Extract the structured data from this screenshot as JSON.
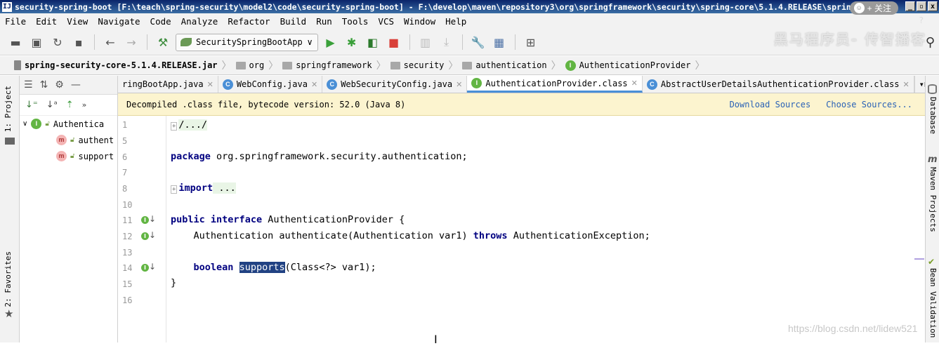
{
  "window": {
    "title": "security-spring-boot [F:\\teach\\spring-security\\model2\\code\\security-spring-boot] - F:\\develop\\maven\\repository3\\org\\springframework\\security\\spring-core\\5.1.4.RELEASE\\sprin...",
    "min": "_",
    "max": "▫",
    "close": "x"
  },
  "menu": [
    "File",
    "Edit",
    "View",
    "Navigate",
    "Code",
    "Analyze",
    "Refactor",
    "Build",
    "Run",
    "Tools",
    "VCS",
    "Window",
    "Help"
  ],
  "follow_button": "+ 关注",
  "help_glyph": "?",
  "watermark": "黑马程序员- 传智播客",
  "run_config": "SecuritySpringBootApp",
  "breadcrumb": {
    "jar": "spring-security-core-5.1.4.RELEASE.jar",
    "parts": [
      "org",
      "springframework",
      "security",
      "authentication"
    ],
    "class_badge": "I",
    "class_name": "AuthenticationProvider"
  },
  "side_tabs": {
    "project": "1: Project",
    "favorites": "2: Favorites"
  },
  "structure": {
    "root": "Authentica",
    "items": [
      "authent",
      "support"
    ]
  },
  "tabs": [
    {
      "label": "ringBootApp.java",
      "badge": ""
    },
    {
      "label": "WebConfig.java",
      "badge": "C"
    },
    {
      "label": "WebSecurityConfig.java",
      "badge": "C"
    },
    {
      "label": "AuthenticationProvider.class",
      "badge": "I",
      "active": true
    },
    {
      "label": "AbstractUserDetailsAuthenticationProvider.class",
      "badge": "C"
    }
  ],
  "tab_overflow": "▾≡₂",
  "notice": {
    "text": "Decompiled .class file, bytecode version: 52.0 (Java 8)",
    "download": "Download Sources",
    "choose": "Choose Sources..."
  },
  "line_numbers": [
    "1",
    "5",
    "6",
    "7",
    "8",
    "10",
    "11",
    "12",
    "13",
    "14",
    "15",
    "16"
  ],
  "code": {
    "l1_fold": "/.../",
    "l6_kw": "package",
    "l6_rest": " org.springframework.security.authentication;",
    "l8_kw": "import",
    "l8_fold": " ...",
    "l11_kw1": "public",
    "l11_kw2": "interface",
    "l11_rest": " AuthenticationProvider {",
    "l12_a": "    Authentication authenticate(Authentication var1) ",
    "l12_kw": "throws",
    "l12_b": " AuthenticationException;",
    "l14_kw": "boolean",
    "l14_sel": "supports",
    "l14_rest": "(Class<?> var1);",
    "l15": "}"
  },
  "right_tabs": {
    "database": "Database",
    "maven": "Maven Projects",
    "bean": "Bean Validation"
  },
  "csdn_watermark": "https://blog.csdn.net/lidew521"
}
